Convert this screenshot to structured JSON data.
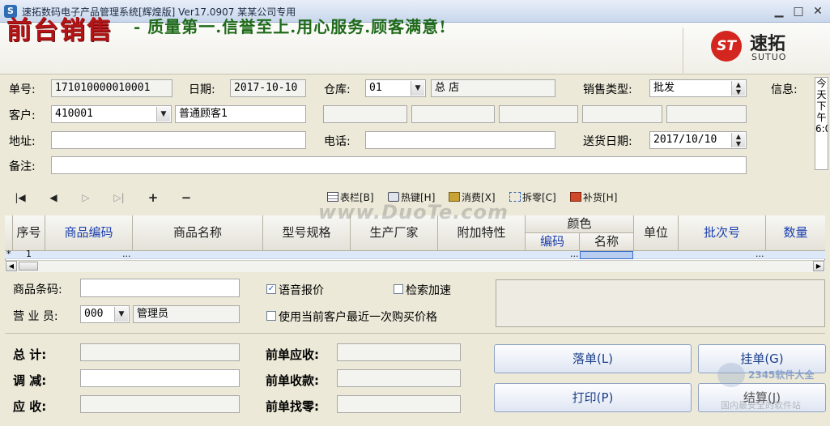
{
  "window": {
    "title": "速拓数码电子产品管理系统[辉煌版] Ver17.0907   某某公司专用",
    "app_icon": "S",
    "minimize": "▁",
    "maximize": "□",
    "close": "✕"
  },
  "banner": {
    "title": "前台销售",
    "slogan": "- 质量第一.信誉至上.用心服务.顾客满意!",
    "logo_mark": "ST",
    "logo_cn": "速拓",
    "logo_en": "SUTUO"
  },
  "form": {
    "order_no_label": "单号:",
    "order_no": "171010000010001",
    "date_label": "日期:",
    "date": "2017-10-10",
    "warehouse_label": "仓库:",
    "warehouse_code": "01",
    "warehouse_name": "总  店",
    "sale_type_label": "销售类型:",
    "sale_type": "批发",
    "info_label": "信息:",
    "info_text": "今天下午6:0",
    "customer_label": "客户:",
    "customer_code": "410001",
    "customer_name": "普通顾客1",
    "address_label": "地址:",
    "address": "",
    "phone_label": "电话:",
    "phone": "",
    "delivery_label": "送货日期:",
    "delivery_date": "2017/10/10",
    "remark_label": "备注:",
    "remark": ""
  },
  "toolbar": {
    "first": "|◀",
    "prev": "◀",
    "next": "▷",
    "last": "▷|",
    "add": "+",
    "remove": "−",
    "columns": "表栏[B]",
    "hotkeys": "热键[H]",
    "consume": "消费[X]",
    "split": "拆零[C]",
    "restock": "补货[H]"
  },
  "watermark": "www.DuoTe.com",
  "grid": {
    "headers": {
      "seq": "序号",
      "code": "商品编码",
      "name": "商品名称",
      "model": "型号规格",
      "maker": "生产厂家",
      "extra": "附加特性",
      "color": "颜色",
      "color_code": "编码",
      "color_name": "名称",
      "unit": "单位",
      "batch": "批次号",
      "qty": "数量"
    },
    "row": {
      "marker": "*",
      "seq": "1",
      "ellipsis": "..."
    }
  },
  "lower": {
    "barcode_label": "商品条码:",
    "barcode": "",
    "clerk_label": "营 业 员:",
    "clerk_code": "000",
    "clerk_name": "管理员",
    "voice_label": "语音报价",
    "search_label": "检索加速",
    "last_price_label": "使用当前客户最近一次购买价格",
    "total_label": "总    计:",
    "adjust_label": "调    减:",
    "receivable_label": "应    收:",
    "prev_receivable_label": "前单应收:",
    "prev_received_label": "前单收款:",
    "prev_change_label": "前单找零:",
    "btn_hold": "落单(L)",
    "btn_pending": "挂单(G)",
    "btn_print": "打印(P)",
    "btn_settle": "结算(J)"
  },
  "side_watermark": {
    "line1": "2345软件大全",
    "line2": "国内最安全的软件站"
  }
}
